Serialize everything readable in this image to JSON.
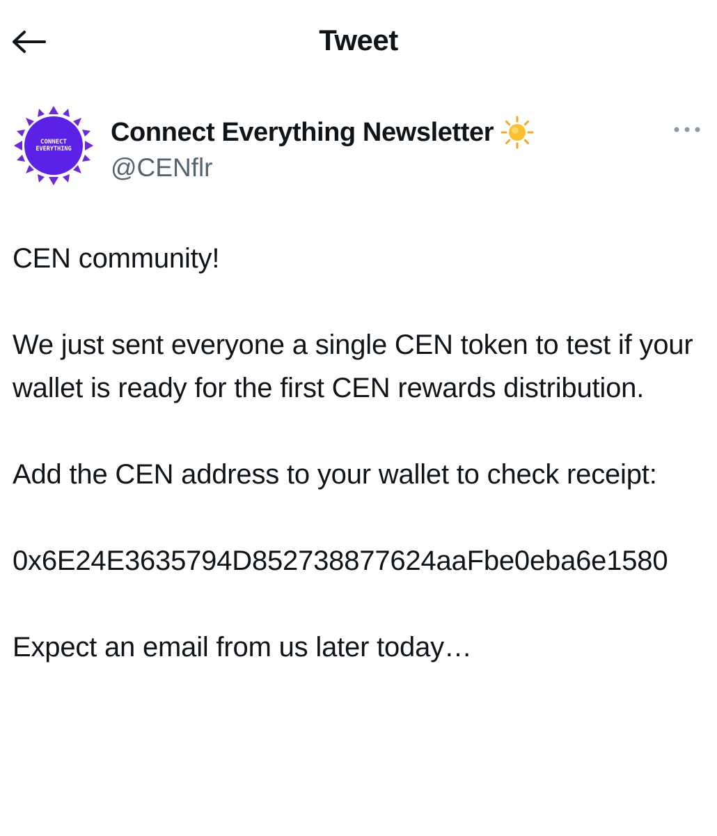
{
  "header": {
    "title": "Tweet",
    "back_icon": "arrow-left-icon"
  },
  "author": {
    "display_name": "Connect Everything Newsletter",
    "emoji": "☀️",
    "handle": "@CENflr",
    "avatar_text_line1": "CONNECT",
    "avatar_text_line2": "EVERYTHING",
    "more_icon": "more-horizontal-icon"
  },
  "tweet": {
    "paragraphs": [
      "CEN community!",
      "We just sent everyone a single CEN token to test if your wallet is ready for the first CEN rewards distribution.",
      "Add the CEN address to your wallet to check receipt:",
      "0x6E24E3635794D852738877624aaFbe0eba6e1580",
      "Expect an email from us later today…"
    ]
  },
  "colors": {
    "text": "#0f1419",
    "secondary_text": "#536471",
    "avatar_bg": "#5b21e6",
    "avatar_ring": "#7c3aed"
  }
}
